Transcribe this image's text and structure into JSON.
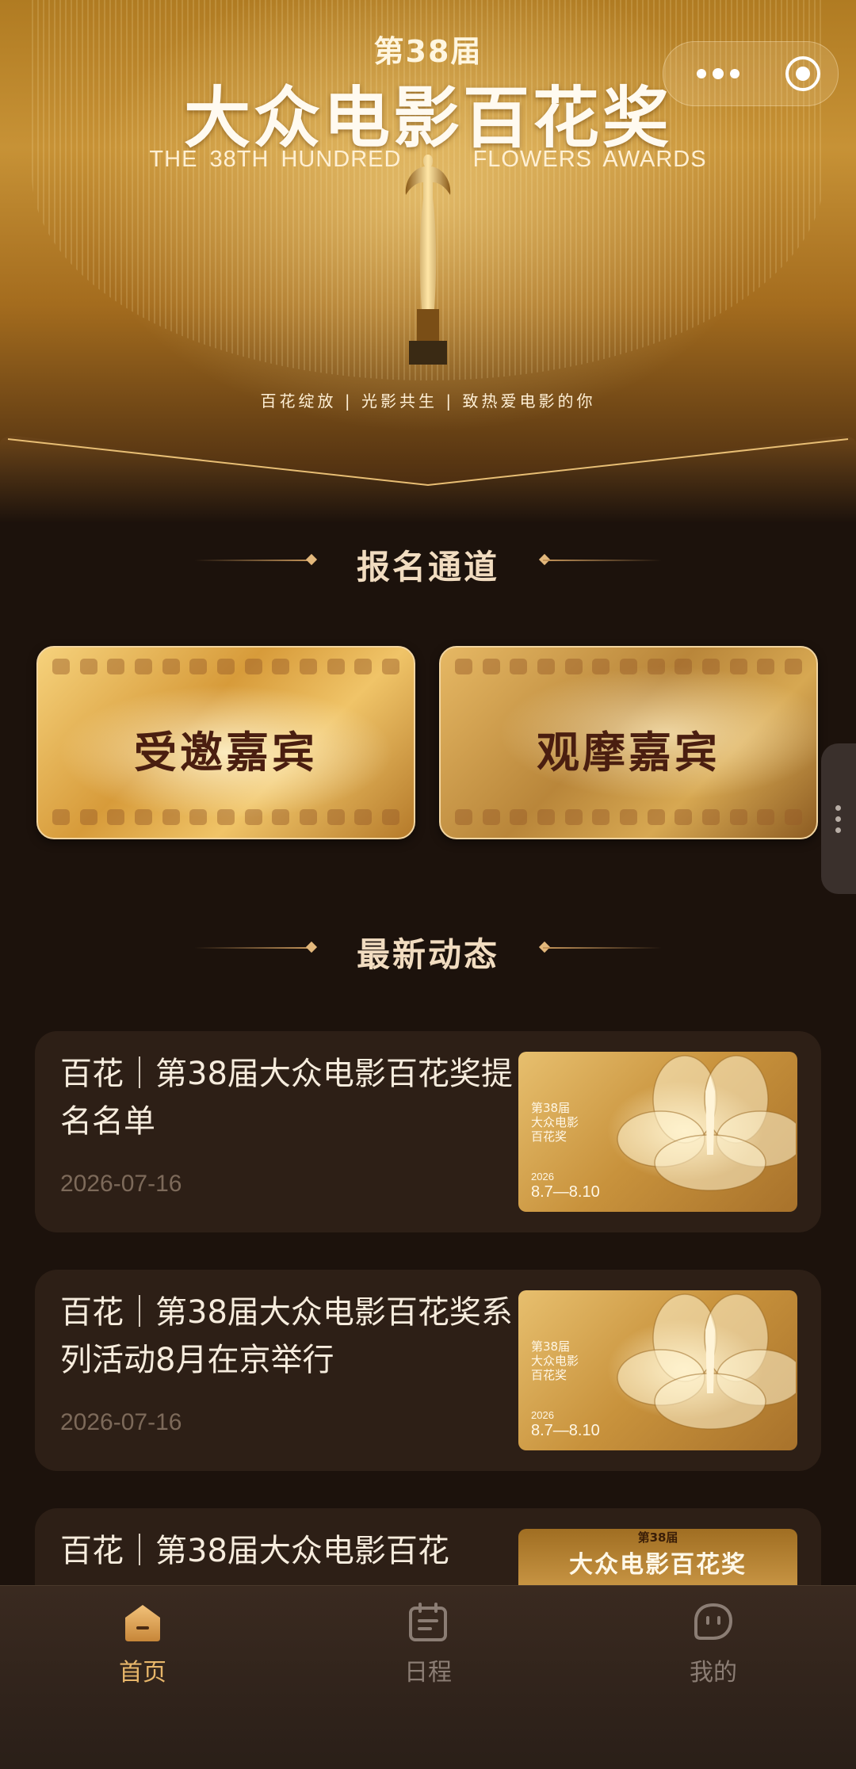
{
  "banner": {
    "edition": "第38届",
    "title": "大众电影百花奖",
    "subtitle_left": "THE 38TH HUNDRED",
    "subtitle_right": "FLOWERS AWARDS",
    "slogan": "百花绽放 | 光影共生 | 致热爱电影的你"
  },
  "capsule": {
    "more_icon": "more-dots-icon",
    "close_icon": "close-target-icon"
  },
  "registration": {
    "heading": "报名通道",
    "buttons": [
      {
        "label": "受邀嘉宾"
      },
      {
        "label": "观摩嘉宾"
      }
    ]
  },
  "news": {
    "heading": "最新动态",
    "items": [
      {
        "title": "百花｜第38届大众电影百花奖提名名单",
        "date": "2026-07-16",
        "thumb": {
          "line1": "第38届",
          "line2": "大众电影",
          "line3": "百花奖",
          "year": "2026",
          "dates": "8.7—8.10"
        }
      },
      {
        "title": "百花｜第38届大众电影百花奖系列活动8月在京举行",
        "date": "2026-07-16",
        "thumb": {
          "line1": "第38届",
          "line2": "大众电影",
          "line3": "百花奖",
          "year": "2026",
          "dates": "8.7—8.10"
        }
      },
      {
        "title": "百花｜第38届大众电影百花",
        "thumb": {
          "edition": "第38届",
          "title": "大众电影百花奖"
        }
      }
    ]
  },
  "tabbar": {
    "tabs": [
      {
        "label": "首页",
        "icon": "home-icon",
        "active": true
      },
      {
        "label": "日程",
        "icon": "calendar-icon",
        "active": false
      },
      {
        "label": "我的",
        "icon": "profile-icon",
        "active": false
      }
    ]
  },
  "colors": {
    "accent": "#e7b66a",
    "background": "#1c120c",
    "card": "#2d1f16"
  }
}
